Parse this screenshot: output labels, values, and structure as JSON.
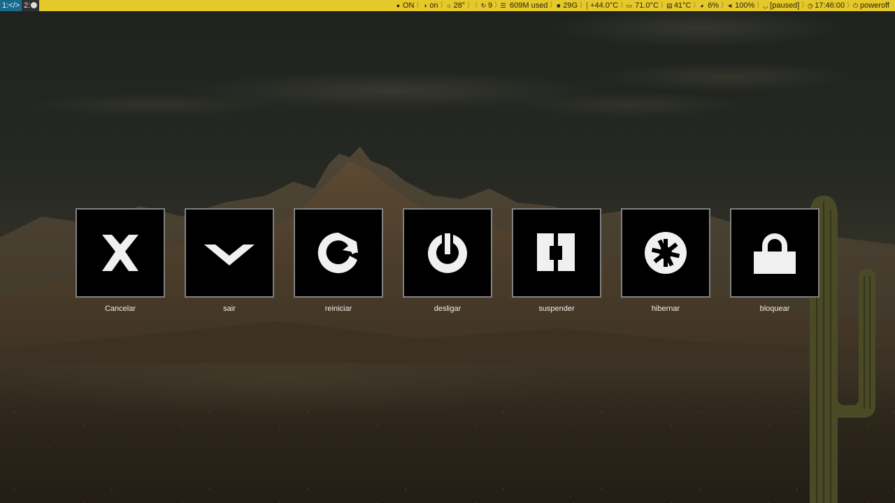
{
  "workspaces": [
    {
      "label": "1:</>",
      "active": true
    },
    {
      "label": "2:",
      "active": false
    }
  ],
  "status": {
    "vpn": "ON",
    "firewall": "on",
    "weather": "28°",
    "updates": "9",
    "memory": "609M used",
    "disk": "29G",
    "cpu_temp": "+44.0°C",
    "gpu_temp": "71.0°C",
    "disk_temp": "41°C",
    "cpu_load": "6%",
    "volume": "100%",
    "music": "[paused]",
    "clock": "17:46:00",
    "power": "poweroff"
  },
  "status_icons": [
    "globe-icon",
    "shield-icon",
    "sun-icon",
    "refresh-icon",
    "memory-icon",
    "disk-icon",
    "thermometer-icon",
    "monitor-icon",
    "hdd-icon",
    "gauge-icon",
    "speaker-icon",
    "headphones-icon",
    "clock-icon",
    "power-icon"
  ],
  "actions": [
    {
      "label": "Cancelar",
      "icon": "cancel-icon"
    },
    {
      "label": "sair",
      "icon": "logout-icon"
    },
    {
      "label": "reiniciar",
      "icon": "restart-icon"
    },
    {
      "label": "desligar",
      "icon": "shutdown-icon"
    },
    {
      "label": "suspender",
      "icon": "suspend-icon"
    },
    {
      "label": "hibernar",
      "icon": "hibernate-icon"
    },
    {
      "label": "bloquear",
      "icon": "lock-icon"
    }
  ],
  "colors": {
    "statusbar_bg": "#e5c82a",
    "statusbar_fg": "#2b2510",
    "active_workspace": "#1a6a8e",
    "tile_bg": "#000000",
    "tile_border": "#808080",
    "icon": "#f0f0f0"
  }
}
